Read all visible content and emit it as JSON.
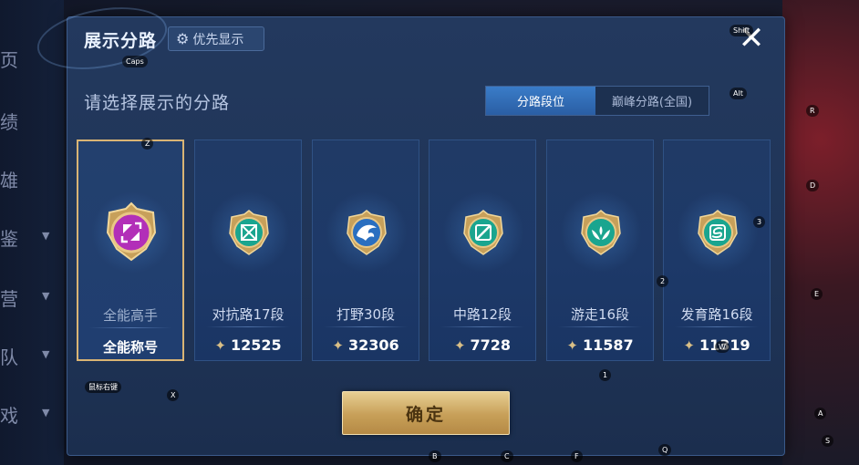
{
  "background": {
    "nav_items": [
      "页",
      "绩",
      "雄",
      "鉴",
      "营",
      "队",
      "戏"
    ]
  },
  "modal": {
    "title": "展示分路",
    "priority_button": "优先显示",
    "subtitle": "请选择展示的分路",
    "tabs": [
      {
        "label": "分路段位",
        "active": true
      },
      {
        "label": "巅峰分路(全国)",
        "active": false
      }
    ],
    "confirm_label": "确定"
  },
  "cards": [
    {
      "name": "全能高手",
      "label": "全能称号",
      "emblem": "all-round-emblem-icon",
      "selected": true
    },
    {
      "name": "对抗路17段",
      "score": "12525",
      "emblem": "clash-lane-emblem-icon",
      "selected": false
    },
    {
      "name": "打野30段",
      "score": "32306",
      "emblem": "jungle-emblem-icon",
      "selected": false
    },
    {
      "name": "中路12段",
      "score": "7728",
      "emblem": "mid-lane-emblem-icon",
      "selected": false
    },
    {
      "name": "游走16段",
      "score": "11587",
      "emblem": "roam-emblem-icon",
      "selected": false
    },
    {
      "name": "发育路16段",
      "score": "11319",
      "emblem": "farm-lane-emblem-icon",
      "selected": false
    }
  ],
  "key_hints": [
    "Shift",
    "Caps",
    "Alt",
    "R",
    "D",
    "E",
    "3",
    "2",
    "Z",
    "W",
    "1",
    "鼠标右键",
    "X",
    "A",
    "S",
    "B",
    "C",
    "F",
    "Q"
  ],
  "colors": {
    "accent_gold": "#d9b474",
    "tab_active": "#3a7cc8",
    "modal_bg": "#23395e"
  }
}
